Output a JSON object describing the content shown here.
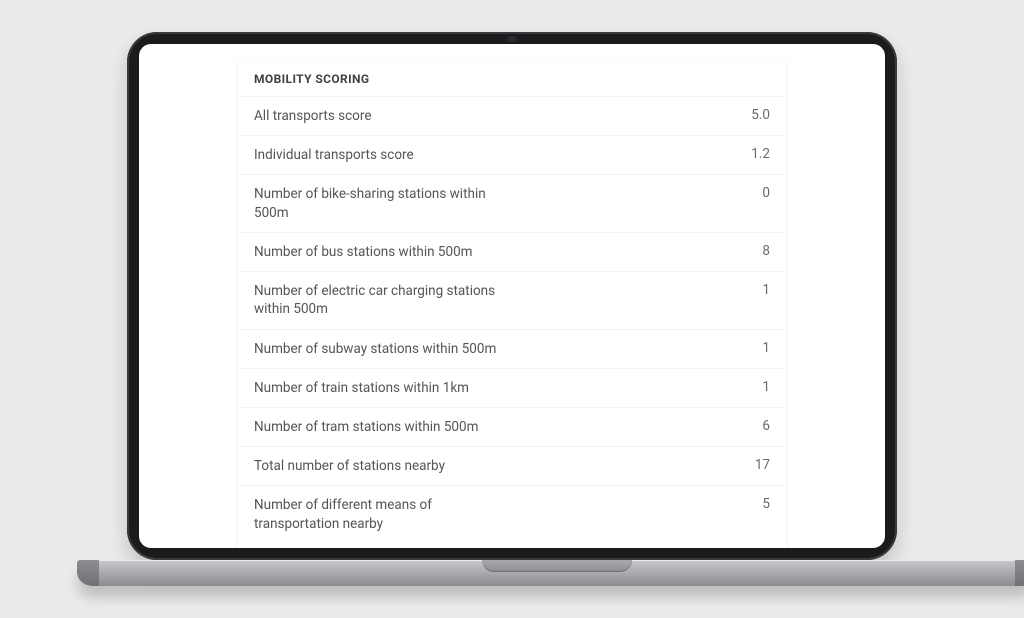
{
  "card": {
    "title": "MOBILITY SCORING",
    "rows": [
      {
        "label": "All transports score",
        "value": "5.0"
      },
      {
        "label": "Individual transports score",
        "value": "1.2"
      },
      {
        "label": "Number of bike-sharing stations within 500m",
        "value": "0"
      },
      {
        "label": "Number of bus stations within 500m",
        "value": "8"
      },
      {
        "label": "Number of electric car charging stations within 500m",
        "value": "1"
      },
      {
        "label": "Number of subway stations within 500m",
        "value": "1"
      },
      {
        "label": "Number of train stations within 1km",
        "value": "1"
      },
      {
        "label": "Number of tram stations within 500m",
        "value": "6"
      },
      {
        "label": "Total number of stations nearby",
        "value": "17"
      },
      {
        "label": "Number of different means of transportation nearby",
        "value": "5"
      }
    ]
  }
}
